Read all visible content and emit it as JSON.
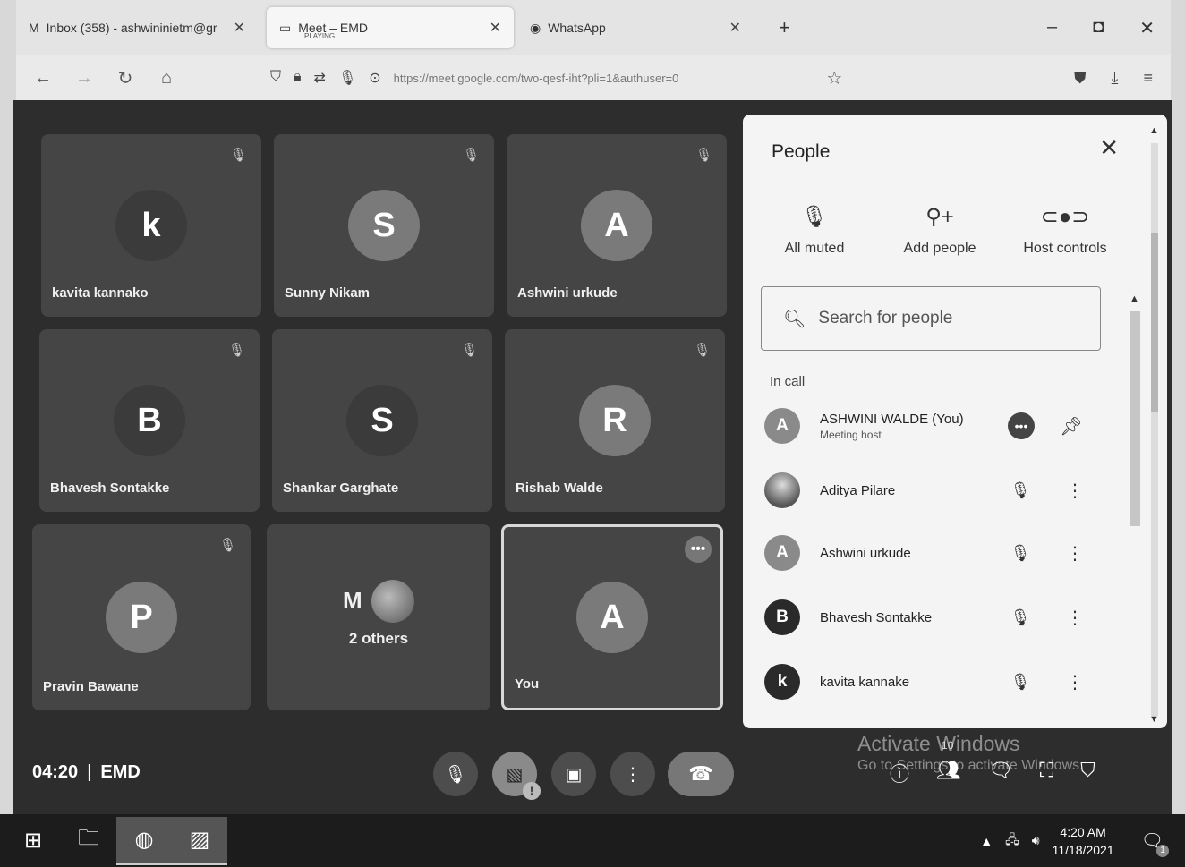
{
  "browser": {
    "tabs": [
      {
        "icon": "gmail-icon",
        "label": "Inbox (358) - ashwininietm@gr",
        "close": "✕"
      },
      {
        "icon": "meet-icon",
        "label": "Meet – EMD",
        "sublabel": "PLAYING",
        "close": "✕"
      },
      {
        "icon": "whatsapp-icon",
        "label": "WhatsApp",
        "close": "✕"
      }
    ],
    "new_tab": "+",
    "window": {
      "minimize": "–",
      "maximize": "◘",
      "close": "✕"
    },
    "url": "https://meet.google.com/two-qesf-iht?pli=1&authuser=0",
    "url_domain": "meet.google.com"
  },
  "meet": {
    "tiles": [
      {
        "initial": "k",
        "name": "kavita kannako",
        "muted": true
      },
      {
        "initial": "S",
        "name": "Sunny Nikam",
        "muted": true
      },
      {
        "initial": "A",
        "name": "Ashwini urkude",
        "muted": true
      },
      {
        "initial": "B",
        "name": "Bhavesh Sontakke",
        "muted": true
      },
      {
        "initial": "S",
        "name": "Shankar Garghate",
        "muted": true
      },
      {
        "initial": "R",
        "name": "Rishab Walde",
        "muted": true
      },
      {
        "initial": "P",
        "name": "Pravin Bawane",
        "muted": true
      }
    ],
    "others_tile": {
      "initial": "M",
      "label": "2 others"
    },
    "you_tile": {
      "initial": "A",
      "name": "You"
    },
    "time": "04:20",
    "meeting_code": "EMD",
    "activate_windows": {
      "title": "Activate Windows",
      "subtitle": "Go to Settings to activate Windows."
    },
    "participants_badge": "10",
    "camera_warning": "!"
  },
  "people_panel": {
    "title": "People",
    "actions": [
      {
        "icon": "mic-off-icon",
        "label": "All muted"
      },
      {
        "icon": "add-person-icon",
        "label": "Add people"
      },
      {
        "icon": "toggle-icon",
        "label": "Host controls"
      }
    ],
    "search_placeholder": "Search for people",
    "section_label": "In call",
    "people": [
      {
        "initial": "A",
        "name": "ASHWINI WALDE (You)",
        "sub": "Meeting host"
      },
      {
        "initial": "",
        "name": "Aditya Pilare",
        "sub": ""
      },
      {
        "initial": "A",
        "name": "Ashwini urkude",
        "sub": ""
      },
      {
        "initial": "B",
        "name": "Bhavesh Sontakke",
        "sub": ""
      },
      {
        "initial": "k",
        "name": "kavita kannake",
        "sub": ""
      }
    ]
  },
  "taskbar": {
    "time": "4:20 AM",
    "date": "11/18/2021",
    "notifications": "1"
  }
}
